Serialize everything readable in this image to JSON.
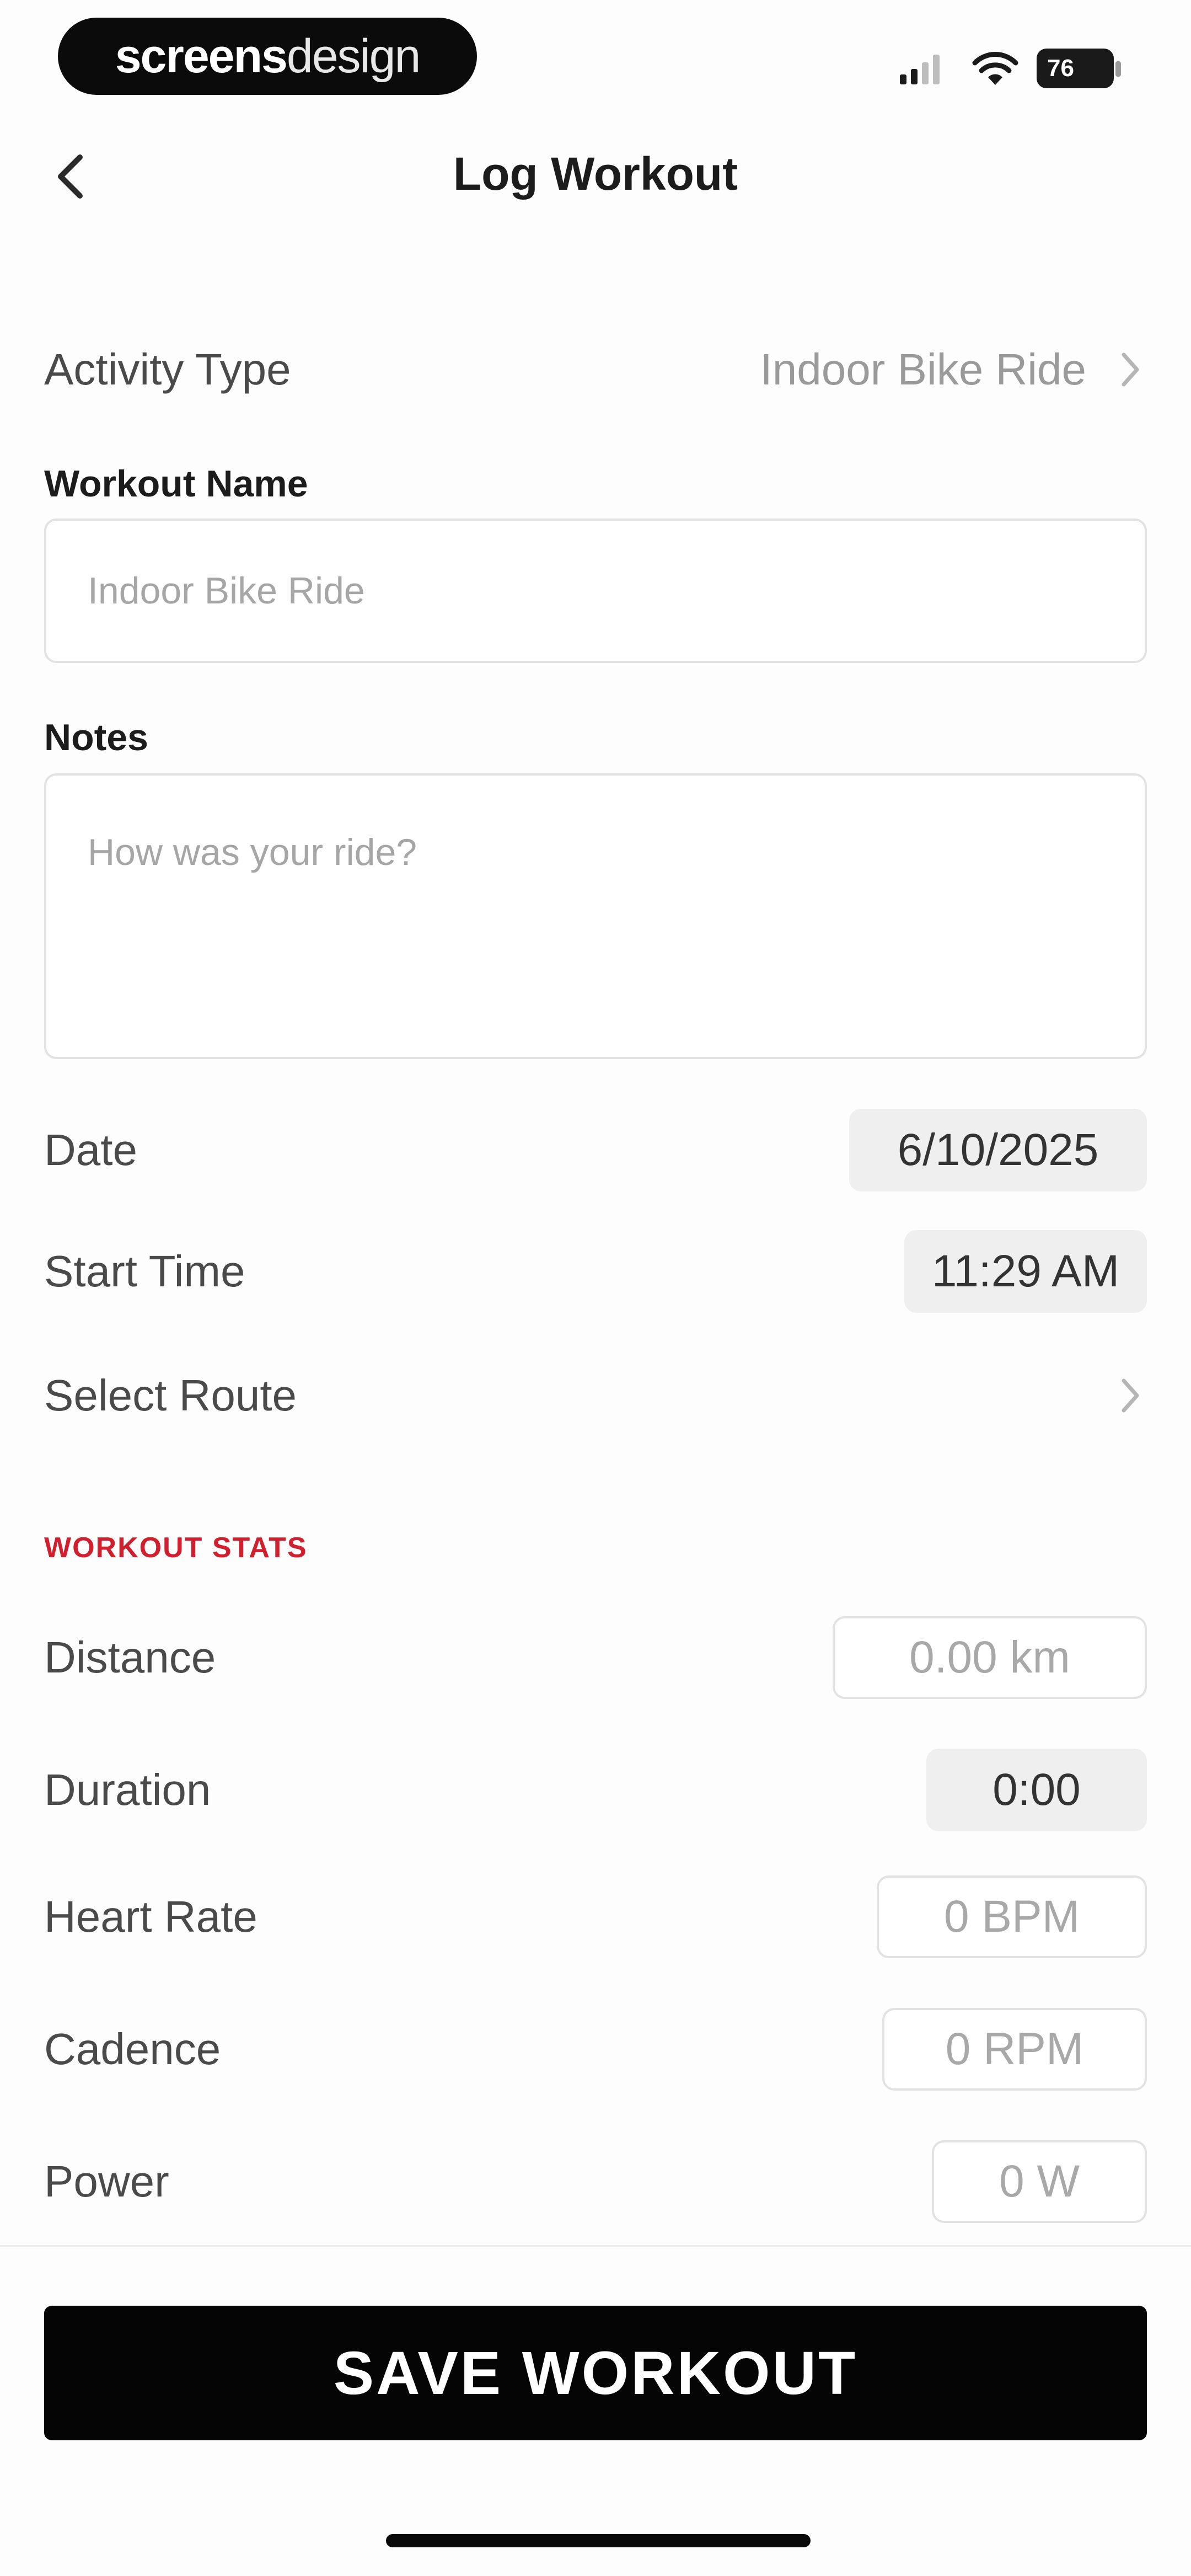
{
  "status_bar": {
    "brand_bold": "screens",
    "brand_light": "design",
    "battery": "76",
    "icons": [
      "signal-icon",
      "wifi-icon",
      "battery-icon"
    ]
  },
  "header": {
    "title": "Log Workout",
    "back_icon": "chevron-left-icon"
  },
  "form": {
    "activity_type": {
      "label": "Activity Type",
      "value": "Indoor Bike Ride"
    },
    "workout_name": {
      "label": "Workout Name",
      "placeholder": "Indoor Bike Ride"
    },
    "notes": {
      "label": "Notes",
      "placeholder": "How was your ride?"
    },
    "date": {
      "label": "Date",
      "value": "6/10/2025"
    },
    "start_time": {
      "label": "Start Time",
      "value": "11:29 AM"
    },
    "route": {
      "label": "Select Route"
    }
  },
  "stats": {
    "header": "WORKOUT STATS",
    "distance": {
      "label": "Distance",
      "value": "0.00 km"
    },
    "duration": {
      "label": "Duration",
      "value": "0:00"
    },
    "heart_rate": {
      "label": "Heart Rate",
      "value": "0 BPM"
    },
    "cadence": {
      "label": "Cadence",
      "value": "0 RPM"
    },
    "power": {
      "label": "Power",
      "value": "0 W"
    }
  },
  "footer": {
    "save_label": "SAVE WORKOUT"
  },
  "colors": {
    "accent": "#d0202f",
    "button": "#050505",
    "background": "#fdfdfd"
  }
}
